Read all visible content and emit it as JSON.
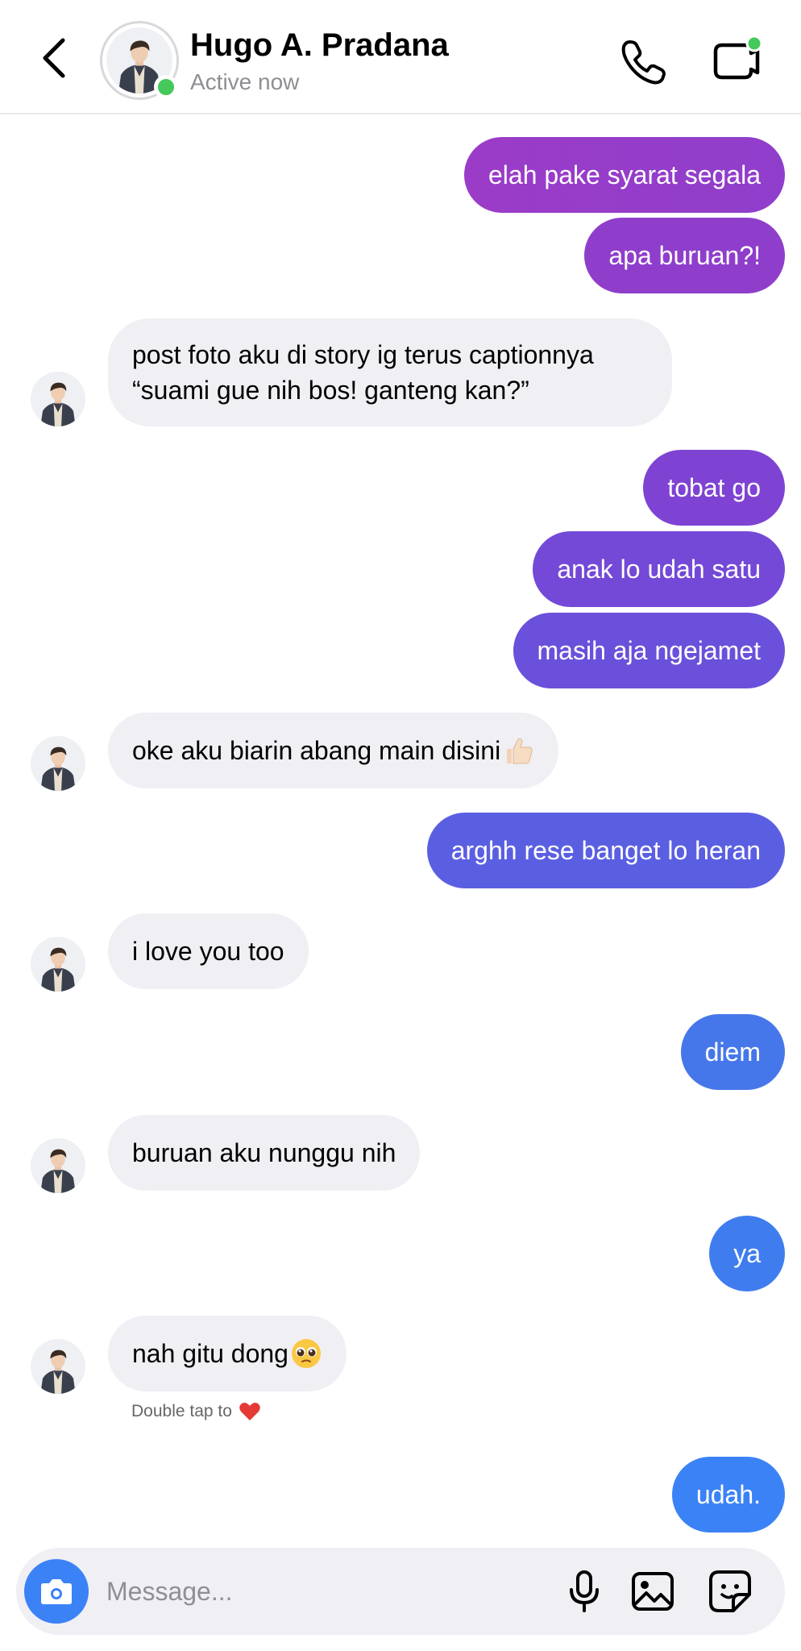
{
  "header": {
    "contact_name": "Hugo A. Pradana",
    "status": "Active now"
  },
  "colors": {
    "sent_gradient": [
      "#9b3cc8",
      "#7e4ad4",
      "#5b63e6",
      "#3b82f6"
    ],
    "received": "#efeff4",
    "online": "#44c95a",
    "camera": "#3b82f6"
  },
  "messages": [
    {
      "from": "me",
      "text": "elah pake syarat segala"
    },
    {
      "from": "me",
      "text": "apa buruan?!"
    },
    {
      "from": "contact",
      "text": "post foto aku di story ig terus captionnya “suami gue nih bos! ganteng kan?”"
    },
    {
      "from": "me",
      "text": "tobat go"
    },
    {
      "from": "me",
      "text": "anak lo udah satu"
    },
    {
      "from": "me",
      "text": "masih aja ngejamet"
    },
    {
      "from": "contact",
      "text": "oke aku biarin abang main disini",
      "emoji": "thumbs-up"
    },
    {
      "from": "me",
      "text": "arghh rese banget lo heran"
    },
    {
      "from": "contact",
      "text": "i love you too"
    },
    {
      "from": "me",
      "text": "diem"
    },
    {
      "from": "contact",
      "text": "buruan aku nunggu nih"
    },
    {
      "from": "me",
      "text": "ya"
    },
    {
      "from": "contact",
      "text": "nah gitu dong",
      "emoji": "pleading-face"
    },
    {
      "from": "me",
      "text": "udah."
    }
  ],
  "reaction_hint": {
    "text": "Double tap to",
    "icon": "red-heart"
  },
  "composer": {
    "placeholder": "Message..."
  }
}
